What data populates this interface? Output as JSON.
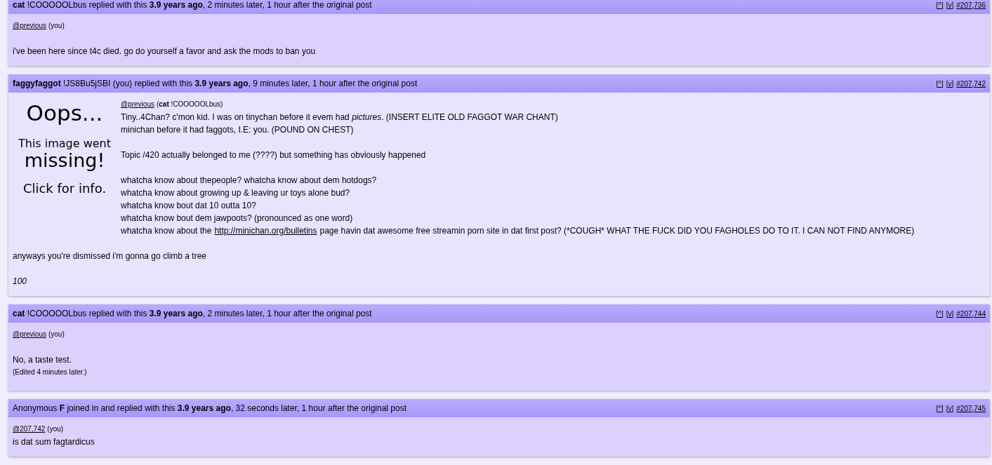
{
  "posts": [
    {
      "header": "**cat** !COOOOOLbus replied with this **3.9 years ago**, 2 minutes later, 1 hour after the original post",
      "nav": [
        "[^]",
        "[v]",
        "#207,736"
      ],
      "highlighted": false,
      "paragraphs": [
        [
          {
            "kind": "cite",
            "link": "@previous",
            "note": "(you)"
          }
        ],
        [
          {
            "kind": "text",
            "text": "i've been here since t4c died. go do yourself a favor and ask the mods to ban you"
          }
        ]
      ]
    },
    {
      "header": "**faggyfaggot** !JS8Bu5jSBI (you) replied with this **3.9 years ago**, 9 minutes later, 1 hour after the original post",
      "nav": [
        "[^]",
        "[v]",
        "#207,742"
      ],
      "highlighted": true,
      "image": {
        "lines": [
          {
            "text": "Oops...",
            "kind": "title"
          },
          {
            "text": "This image went",
            "kind": "small"
          },
          {
            "text": "missing!",
            "kind": "big"
          },
          {
            "text": "Click for info.",
            "kind": "info"
          }
        ]
      },
      "paragraphs": [
        [
          {
            "kind": "cite",
            "link": "@previous",
            "note": "(**cat** !COOOOOLbus)"
          },
          {
            "kind": "text",
            "text": "Tiny..4Chan? c'mon kid. I was on tinychan before it evem had *pictures*. (INSERT ELITE OLD FAGGOT WAR CHANT)"
          },
          {
            "kind": "text",
            "text": "minichan before it had faggots, I.E: you. (POUND ON CHEST)"
          }
        ],
        [
          {
            "kind": "text",
            "text": "Topic /420 actually belonged to me (????) but something has obviously happened"
          }
        ],
        [
          {
            "kind": "text",
            "text": "whatcha know about thepeople? whatcha know about dem hotdogs?"
          },
          {
            "kind": "text",
            "text": "whatcha know about growing up & leaving ur toys alone bud?"
          },
          {
            "kind": "text",
            "text": "whatcha know bout dat 10 outta 10?"
          },
          {
            "kind": "text",
            "text": "whatcha know bout dem jawpoots? (pronounced as one word)"
          },
          {
            "kind": "text",
            "text": "whatcha know about the",
            "link": "http://minichan.org/bulletins",
            "after": "page havin dat awesome free streamin porn site in dat first post? (*COUGH* WHAT THE FUCK DID YOU FAGHOLES DO TO IT. I CAN NOT FIND ANYMORE)"
          }
        ],
        [
          {
            "kind": "text",
            "text": "anyways you're dismissed i'm gonna go climb a tree"
          }
        ],
        [
          {
            "kind": "italic",
            "text": "100"
          }
        ]
      ]
    },
    {
      "header": "**cat** !COOOOOLbus replied with this **3.9 years ago**, 2 minutes later, 1 hour after the original post",
      "nav": [
        "[^]",
        "[v]",
        "#207,744"
      ],
      "highlighted": false,
      "paragraphs": [
        [
          {
            "kind": "cite",
            "link": "@previous",
            "note": "(you)"
          }
        ],
        [
          {
            "kind": "text",
            "text": "No, a taste test."
          },
          {
            "kind": "edit",
            "text": "(Edited 4 minutes later.)"
          }
        ]
      ]
    },
    {
      "header": "Anonymous **F** joined in and replied with this **3.9 years ago**, 32 seconds later, 1 hour after the original post",
      "nav": [
        "[^]",
        "[v]",
        "#207,745"
      ],
      "highlighted": false,
      "paragraphs": [
        [
          {
            "kind": "cite",
            "link": "@207,742",
            "note": "(you)"
          },
          {
            "kind": "text",
            "text": "is dat sum fagtardicus"
          }
        ]
      ]
    }
  ]
}
